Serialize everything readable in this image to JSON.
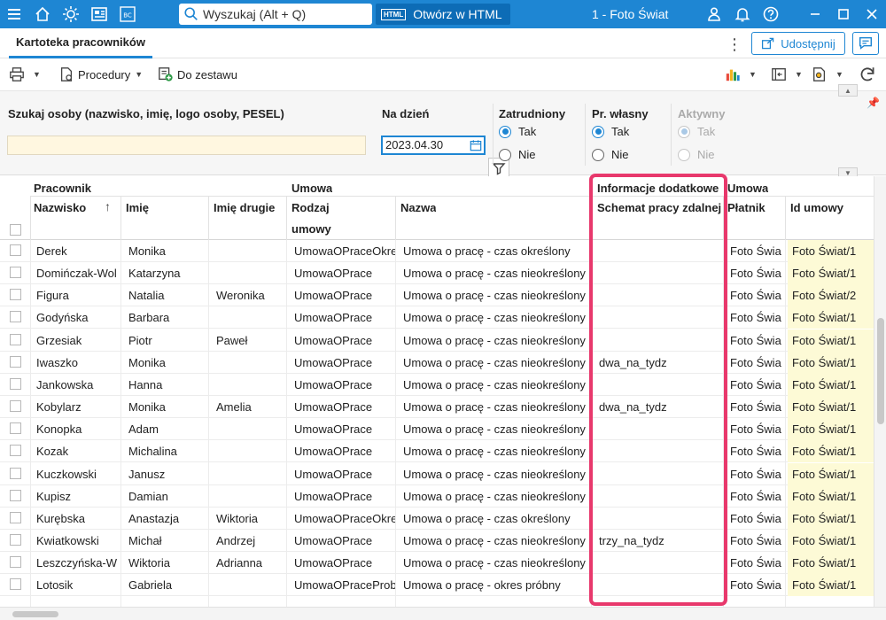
{
  "topbar": {
    "search_placeholder": "Wyszukaj (Alt + Q)",
    "open_html_badge": "HTML",
    "open_html_label": "Otwórz w HTML",
    "company": "1 - Foto Świat",
    "bc_badge": "BC"
  },
  "tabs": {
    "active_tab": "Kartoteka pracowników",
    "kebab": "⋮",
    "share_label": "Udostępnij"
  },
  "toolbar": {
    "procedures_label": "Procedury",
    "add_to_set_label": "Do zestawu"
  },
  "filters": {
    "search_label": "Szukaj osoby (nazwisko, imię, logo osoby, PESEL)",
    "search_value": "",
    "date_label": "Na dzień",
    "date_value": "2023.04.30",
    "employed_label": "Zatrudniony",
    "own_employee_label": "Pr. własny",
    "active_label": "Aktywny",
    "yes_label": "Tak",
    "no_label": "Nie"
  },
  "grid": {
    "group_headers": {
      "employee": "Pracownik",
      "contract": "Umowa",
      "additional_info": "Informacje dodatkowe",
      "contract2": "Umowa"
    },
    "columns": {
      "surname": "Nazwisko",
      "name": "Imię",
      "second_name": "Imię drugie",
      "contract_type_line1": "Rodzaj",
      "contract_type_line2": "umowy",
      "contract_name": "Nazwa",
      "remote_schema": "Schemat pracy zdalnej",
      "payer": "Płatnik",
      "contract_id": "Id umowy"
    },
    "rows": [
      {
        "surname": "Derek",
        "name": "Monika",
        "second": "",
        "type": "UmowaOPraceOkre",
        "cname": "Umowa o pracę - czas określony",
        "schema": "",
        "payer": "Foto Świa",
        "id": "Foto Świat/1"
      },
      {
        "surname": "Domińczak-Wol",
        "name": "Katarzyna",
        "second": "",
        "type": "UmowaOPrace",
        "cname": "Umowa o pracę - czas nieokreślony",
        "schema": "",
        "payer": "Foto Świa",
        "id": "Foto Świat/1"
      },
      {
        "surname": "Figura",
        "name": "Natalia",
        "second": "Weronika",
        "type": "UmowaOPrace",
        "cname": "Umowa o pracę - czas nieokreślony",
        "schema": "",
        "payer": "Foto Świa",
        "id": "Foto Świat/2"
      },
      {
        "surname": "Godyńska",
        "name": "Barbara",
        "second": "",
        "type": "UmowaOPrace",
        "cname": "Umowa o pracę - czas nieokreślony",
        "schema": "",
        "payer": "Foto Świa",
        "id": "Foto Świat/1"
      },
      {
        "surname": "Grzesiak",
        "name": "Piotr",
        "second": "Paweł",
        "type": "UmowaOPrace",
        "cname": "Umowa o pracę - czas nieokreślony",
        "schema": "",
        "payer": "Foto Świa",
        "id": "Foto Świat/1"
      },
      {
        "surname": "Iwaszko",
        "name": "Monika",
        "second": "",
        "type": "UmowaOPrace",
        "cname": "Umowa o pracę - czas nieokreślony",
        "schema": "dwa_na_tydz",
        "payer": "Foto Świa",
        "id": "Foto Świat/1"
      },
      {
        "surname": "Jankowska",
        "name": "Hanna",
        "second": "",
        "type": "UmowaOPrace",
        "cname": "Umowa o pracę - czas nieokreślony",
        "schema": "",
        "payer": "Foto Świa",
        "id": "Foto Świat/1"
      },
      {
        "surname": "Kobylarz",
        "name": "Monika",
        "second": "Amelia",
        "type": "UmowaOPrace",
        "cname": "Umowa o pracę - czas nieokreślony",
        "schema": "dwa_na_tydz",
        "payer": "Foto Świa",
        "id": "Foto Świat/1"
      },
      {
        "surname": "Konopka",
        "name": "Adam",
        "second": "",
        "type": "UmowaOPrace",
        "cname": "Umowa o pracę - czas nieokreślony",
        "schema": "",
        "payer": "Foto Świa",
        "id": "Foto Świat/1"
      },
      {
        "surname": "Kozak",
        "name": "Michalina",
        "second": "",
        "type": "UmowaOPrace",
        "cname": "Umowa o pracę - czas nieokreślony",
        "schema": "",
        "payer": "Foto Świa",
        "id": "Foto Świat/1"
      },
      {
        "surname": "Kuczkowski",
        "name": "Janusz",
        "second": "",
        "type": "UmowaOPrace",
        "cname": "Umowa o pracę - czas nieokreślony",
        "schema": "",
        "payer": "Foto Świa",
        "id": "Foto Świat/1"
      },
      {
        "surname": "Kupisz",
        "name": "Damian",
        "second": "",
        "type": "UmowaOPrace",
        "cname": "Umowa o pracę - czas nieokreślony",
        "schema": "",
        "payer": "Foto Świa",
        "id": "Foto Świat/1"
      },
      {
        "surname": "Kurębska",
        "name": "Anastazja",
        "second": "Wiktoria",
        "type": "UmowaOPraceOkre",
        "cname": "Umowa o pracę - czas określony",
        "schema": "",
        "payer": "Foto Świa",
        "id": "Foto Świat/1"
      },
      {
        "surname": "Kwiatkowski",
        "name": "Michał",
        "second": "Andrzej",
        "type": "UmowaOPrace",
        "cname": "Umowa o pracę - czas nieokreślony",
        "schema": "trzy_na_tydz",
        "payer": "Foto Świa",
        "id": "Foto Świat/1"
      },
      {
        "surname": "Leszczyńska-W",
        "name": "Wiktoria",
        "second": "Adrianna",
        "type": "UmowaOPrace",
        "cname": "Umowa o pracę - czas nieokreślony",
        "schema": "",
        "payer": "Foto Świa",
        "id": "Foto Świat/1"
      },
      {
        "surname": "Lotosik",
        "name": "Gabriela",
        "second": "",
        "type": "UmowaOPraceProb",
        "cname": "Umowa o pracę - okres próbny",
        "schema": "",
        "payer": "Foto Świa",
        "id": "Foto Świat/1"
      }
    ]
  },
  "colors": {
    "accent": "#1e86d3",
    "highlight": "#e8386c",
    "id_column_bg": "#fdfad6",
    "search_bg": "#fff7e0"
  }
}
